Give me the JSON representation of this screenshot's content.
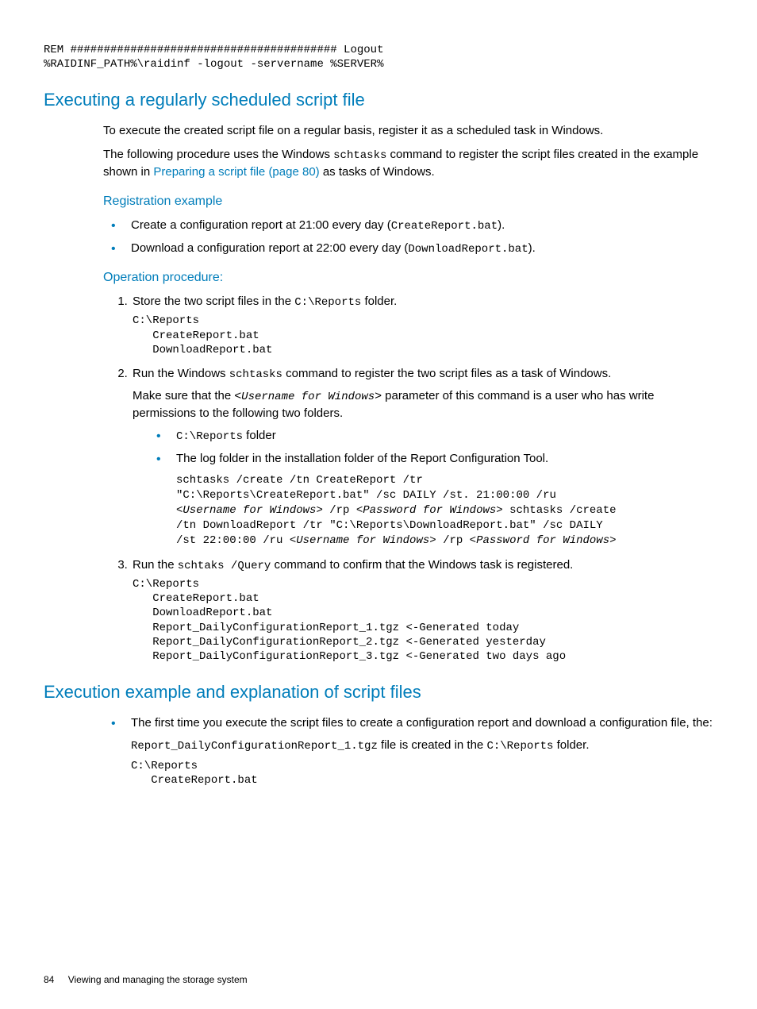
{
  "topcode": {
    "l1": "REM ######################################## Logout",
    "l2": "%RAIDINF_PATH%\\raidinf -logout -servername %SERVER%"
  },
  "h2a": "Executing a regularly scheduled script file",
  "p1": "To execute the created script file on a regular basis, register it as a scheduled task in Windows.",
  "p2a": "The following procedure uses the Windows ",
  "p2b": "schtasks",
  "p2c": " command to register the script files created in the example shown in ",
  "p2link": "Preparing a script file (page 80)",
  "p2d": " as tasks of Windows.",
  "h3a": "Registration example",
  "b1a": "Create a configuration report at 21:00 every day (",
  "b1b": "CreateReport.bat",
  "b1c": ").",
  "b2a": "Download a configuration report at 22:00 every day (",
  "b2b": "DownloadReport.bat",
  "b2c": ").",
  "h3b": "Operation procedure:",
  "o1a": "Store the two script files in the ",
  "o1b": "C:\\Reports",
  "o1c": " folder.",
  "code1": "C:\\Reports\n   CreateReport.bat\n   DownloadReport.bat",
  "o2a": "Run the Windows ",
  "o2b": "schtasks",
  "o2c": " command to register the two script files as a task of Windows.",
  "o2p2a": "Make sure that the <",
  "o2p2b": "Username for Windows",
  "o2p2c": "> parameter of this command is a user who has write permissions to the following two folders.",
  "nb1a": "C:\\Reports",
  "nb1b": " folder",
  "nb2": "The log folder in the installation folder of the Report Configuration Tool.",
  "code2_l1": "schtasks /create /tn CreateReport /tr",
  "code2_l2": "\"C:\\Reports\\CreateReport.bat\" /sc DAILY /st. 21:00:00 /ru",
  "code2_l3a": "<",
  "code2_l3b": "Username for Windows",
  "code2_l3c": "> /rp <",
  "code2_l3d": "Password for Windows",
  "code2_l3e": "> schtasks /create",
  "code2_l4": "/tn DownloadReport /tr \"C:\\Reports\\DownloadReport.bat\" /sc DAILY",
  "code2_l5a": "/st 22:00:00 /ru <",
  "code2_l5b": "Username for Windows",
  "code2_l5c": "> /rp <",
  "code2_l5d": "Password for Windows",
  "code2_l5e": ">",
  "o3a": "Run the ",
  "o3b": "schtaks /Query",
  "o3c": " command to confirm that the Windows task is registered.",
  "code3": "C:\\Reports\n   CreateReport.bat\n   DownloadReport.bat\n   Report_DailyConfigurationReport_1.tgz <-Generated today\n   Report_DailyConfigurationReport_2.tgz <-Generated yesterday\n   Report_DailyConfigurationReport_3.tgz <-Generated two days ago",
  "h2b": "Execution example and explanation of script files",
  "bb1": "The first time you execute the script files to create a configuration report and download a configuration file, the:",
  "pp1a": "Report_DailyConfigurationReport_1.tgz",
  "pp1b": " file is created in the ",
  "pp1c": "C:\\Reports",
  "pp1d": " folder.",
  "code4": "C:\\Reports\n   CreateReport.bat",
  "footer_page": "84",
  "footer_title": "Viewing and managing the storage system"
}
